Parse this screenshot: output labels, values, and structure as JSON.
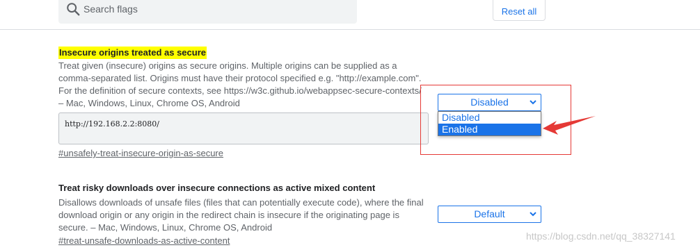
{
  "header": {
    "search_placeholder": "Search flags",
    "reset_label": "Reset all"
  },
  "flags": [
    {
      "title": "Insecure origins treated as secure",
      "description_lines": [
        "Treat given (insecure) origins as secure origins. Multiple origins can be supplied as a",
        "comma-separated list. Origins must have their protocol specified e.g. \"http://example.com\".",
        "For the definition of secure contexts, see https://w3c.github.io/webappsec-secure-contexts/",
        "– Mac, Windows, Linux, Chrome OS, Android"
      ],
      "textarea_value": "http://192.168.2.2:8080/",
      "link": "#unsafely-treat-insecure-origin-as-secure",
      "select_value": "Disabled",
      "dropdown_options": [
        "Disabled",
        "Enabled"
      ],
      "highlighted_option": "Enabled"
    },
    {
      "title": "Treat risky downloads over insecure connections as active mixed content",
      "description_lines": [
        "Disallows downloads of unsafe files (files that can potentially execute code), where the final",
        "download origin or any origin in the redirect chain is insecure if the originating page is",
        "secure. – Mac, Windows, Linux, Chrome OS, Android"
      ],
      "link": "#treat-unsafe-downloads-as-active-content",
      "select_value": "Default"
    }
  ],
  "watermark": "https://blog.csdn.net/qq_38327141",
  "colors": {
    "accent": "#1a73e8",
    "highlight": "#ffff00",
    "annotation": "#e53935"
  }
}
